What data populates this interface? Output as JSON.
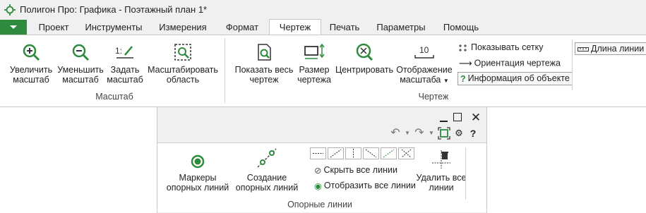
{
  "app": {
    "title": "Полигон Про: Графика - Поэтажный план 1*"
  },
  "tabs": [
    {
      "label": "Проект"
    },
    {
      "label": "Инструменты"
    },
    {
      "label": "Измерения"
    },
    {
      "label": "Формат"
    },
    {
      "label": "Чертеж",
      "active": true
    },
    {
      "label": "Печать"
    },
    {
      "label": "Параметры"
    },
    {
      "label": "Помощь"
    }
  ],
  "ribbon": {
    "scale_group": {
      "label": "Масштаб",
      "buttons": [
        {
          "label1": "Увеличить",
          "label2": "масштаб",
          "icon": "zoom-in-icon"
        },
        {
          "label1": "Уменьшить",
          "label2": "масштаб",
          "icon": "zoom-out-icon"
        },
        {
          "label1": "Задать",
          "label2": "масштаб",
          "icon": "set-scale-icon"
        },
        {
          "label1": "Масштабировать",
          "label2": "область",
          "icon": "zoom-area-icon"
        }
      ]
    },
    "drawing_group": {
      "label": "Чертеж",
      "buttons": [
        {
          "label1": "Показать весь",
          "label2": "чертеж",
          "icon": "show-all-icon"
        },
        {
          "label1": "Размер",
          "label2": "чертежа",
          "icon": "drawing-size-icon"
        },
        {
          "label1": "Центрировать",
          "label2": "",
          "icon": "center-icon"
        },
        {
          "label1": "Отображение",
          "label2": "масштаба",
          "icon": "scale-display-icon",
          "scale_value": "10"
        }
      ],
      "small": {
        "show_grid": "Показывать сетку",
        "orientation": "Ориентация чертежа",
        "object_info": "Информация об объекте",
        "line_length": "Длина линии"
      }
    }
  },
  "window2": {
    "group_label": "Опорные линии",
    "buttons": {
      "markers": {
        "label1": "Маркеры",
        "label2": "опорных линий"
      },
      "create": {
        "label1": "Создание",
        "label2": "опорных линий"
      },
      "hide_all": "Скрыть все линии",
      "show_all": "Отобразить все линии",
      "delete_all": {
        "label1": "Удалить все",
        "label2": "линии"
      }
    }
  },
  "colors": {
    "accent": "#2e8b3e",
    "icon_dark": "#333333",
    "ribbon_bg": "#ffffff",
    "chrome_bg": "#f0f0f0"
  }
}
